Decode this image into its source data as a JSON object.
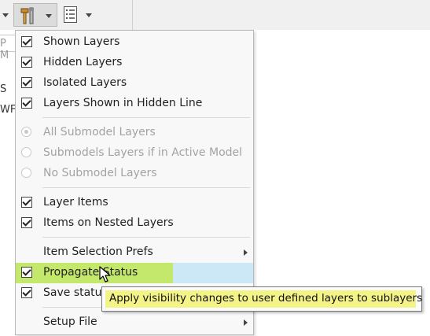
{
  "toolbar": {
    "icons": [
      "chevron-down-icon",
      "tools-icon",
      "chevron-down-icon",
      "list-document-icon",
      "chevron-down-icon"
    ]
  },
  "background": {
    "field_text": "P M",
    "line1": "S",
    "line2": "WF"
  },
  "menu": {
    "items": [
      {
        "label": "Shown Layers",
        "type": "check",
        "checked": true
      },
      {
        "label": "Hidden Layers",
        "type": "check",
        "checked": true
      },
      {
        "label": "Isolated Layers",
        "type": "check",
        "checked": true
      },
      {
        "label": "Layers Shown in Hidden Line",
        "type": "check",
        "checked": true
      },
      {
        "label": "All Submodel Layers",
        "type": "radio",
        "selected": true,
        "disabled": true
      },
      {
        "label": "Submodels Layers if in Active Model",
        "type": "radio",
        "selected": false,
        "disabled": true
      },
      {
        "label": "No Submodel Layers",
        "type": "radio",
        "selected": false,
        "disabled": true
      },
      {
        "label": "Layer Items",
        "type": "check",
        "checked": true
      },
      {
        "label": "Items on Nested Layers",
        "type": "check",
        "checked": true
      },
      {
        "label": "Item Selection Prefs",
        "type": "submenu"
      },
      {
        "label": "Propagate Status",
        "type": "check",
        "checked": true,
        "highlighted": true
      },
      {
        "label": "Save status",
        "type": "check",
        "checked": true
      },
      {
        "label": "Setup File",
        "type": "submenu"
      }
    ]
  },
  "tooltip": {
    "text": "Apply visibility changes to user defined layers to sublayers"
  },
  "colors": {
    "highlight_blue": "#cce8f6",
    "highlight_green": "#c4e86b",
    "tooltip_yellow": "#f3f388"
  }
}
